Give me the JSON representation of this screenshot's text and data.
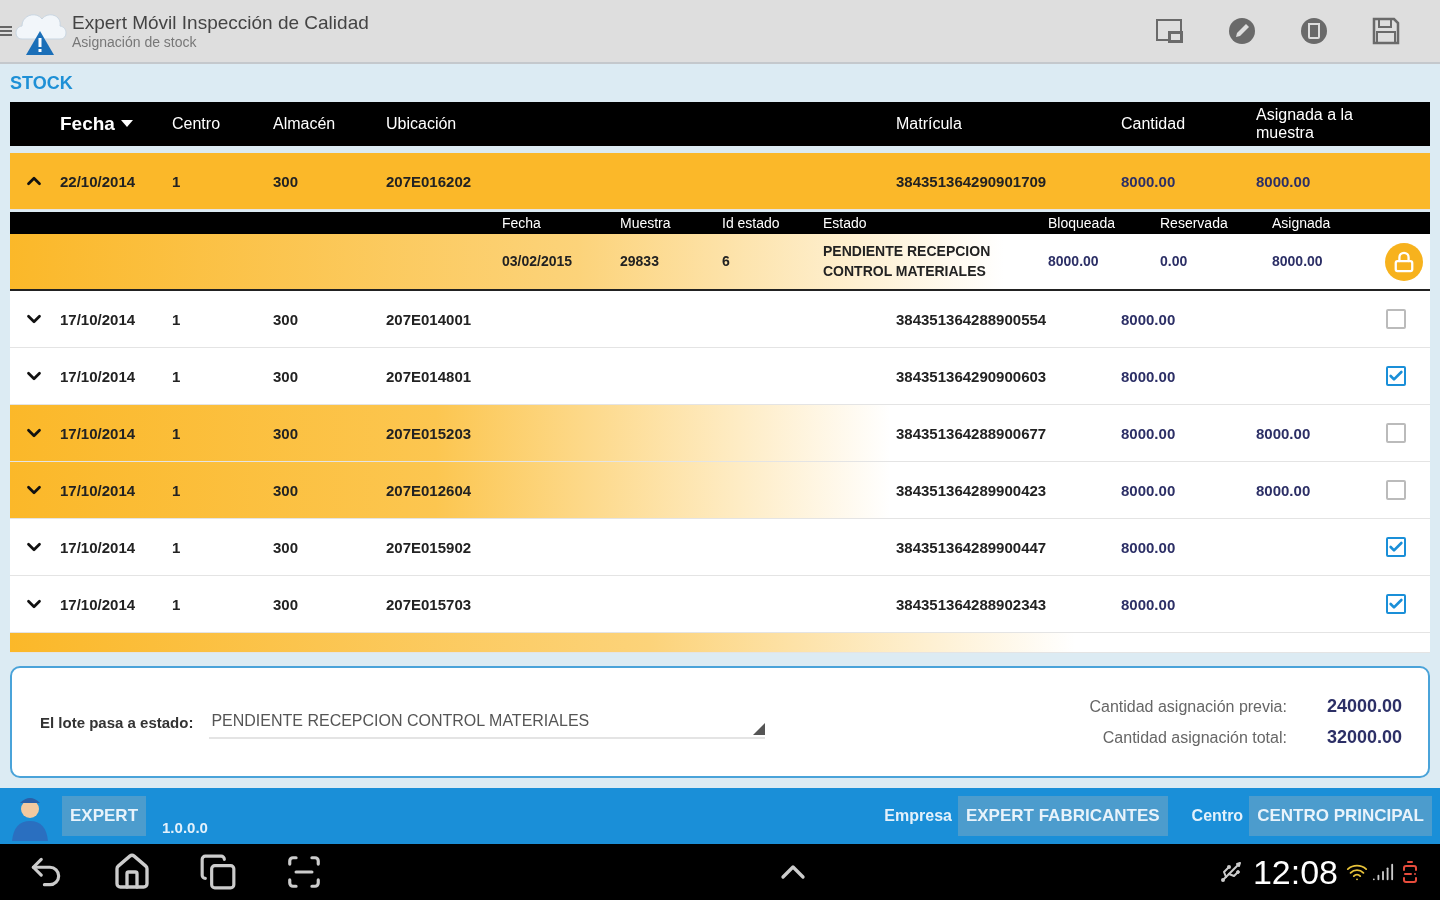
{
  "app_bar": {
    "title": "Expert Móvil Inspección de Calidad",
    "subtitle": "Asignación de stock"
  },
  "section_title": "STOCK",
  "table": {
    "columns": [
      {
        "label": "Fecha",
        "sorted": true
      },
      {
        "label": "Centro",
        "sorted": false
      },
      {
        "label": "Almacén",
        "sorted": false
      },
      {
        "label": "Ubicación",
        "sorted": false
      },
      {
        "label": "Matrícula",
        "sorted": false
      },
      {
        "label": "Cantidad",
        "sorted": false
      },
      {
        "label": "Asignada a la muestra",
        "sorted": false
      }
    ],
    "rows": [
      {
        "expanded": true,
        "highlighted": true,
        "fecha": "22/10/2014",
        "centro": "1",
        "almacen": "300",
        "ubicacion": "207E016202",
        "matricula": "384351364290901709",
        "cantidad": "8000.00",
        "asignada": "8000.00",
        "detail": {
          "columns": [
            "Fecha",
            "Muestra",
            "Id estado",
            "Estado",
            "Bloqueada",
            "Reservada",
            "Asignada"
          ],
          "cells": [
            "03/02/2015",
            "29833",
            "6",
            "PENDIENTE RECEPCION CONTROL MATERIALES",
            "8000.00",
            "0.00",
            "8000.00"
          ],
          "locked": true
        }
      },
      {
        "expanded": false,
        "highlighted": false,
        "checked": false,
        "fecha": "17/10/2014",
        "centro": "1",
        "almacen": "300",
        "ubicacion": "207E014001",
        "matricula": "384351364288900554",
        "cantidad": "8000.00"
      },
      {
        "expanded": false,
        "highlighted": false,
        "checked": true,
        "fecha": "17/10/2014",
        "centro": "1",
        "almacen": "300",
        "ubicacion": "207E014801",
        "matricula": "384351364290900603",
        "cantidad": "8000.00"
      },
      {
        "expanded": false,
        "highlighted": true,
        "checked": false,
        "fecha": "17/10/2014",
        "centro": "1",
        "almacen": "300",
        "ubicacion": "207E015203",
        "matricula": "384351364288900677",
        "cantidad": "8000.00",
        "asignada": "8000.00"
      },
      {
        "expanded": false,
        "highlighted": true,
        "checked": false,
        "fecha": "17/10/2014",
        "centro": "1",
        "almacen": "300",
        "ubicacion": "207E012604",
        "matricula": "384351364289900423",
        "cantidad": "8000.00",
        "asignada": "8000.00"
      },
      {
        "expanded": false,
        "highlighted": false,
        "checked": true,
        "fecha": "17/10/2014",
        "centro": "1",
        "almacen": "300",
        "ubicacion": "207E015902",
        "matricula": "384351364289900447",
        "cantidad": "8000.00"
      },
      {
        "expanded": false,
        "highlighted": false,
        "checked": true,
        "fecha": "17/10/2014",
        "centro": "1",
        "almacen": "300",
        "ubicacion": "207E015703",
        "matricula": "384351364288902343",
        "cantidad": "8000.00"
      },
      {
        "kind": "partial",
        "highlighted": true
      }
    ]
  },
  "batch_state": {
    "label": "El lote pasa a estado:",
    "value": "PENDIENTE RECEPCION CONTROL MATERIALES"
  },
  "totals": [
    {
      "label": "Cantidad asignación previa:",
      "value": "24000.00"
    },
    {
      "label": "Cantidad asignación total:",
      "value": "32000.00"
    }
  ],
  "footer": {
    "user": "EXPERT",
    "version": "1.0.0.0",
    "company_label": "Empresa",
    "company": "EXPERT FABRICANTES",
    "center_label": "Centro",
    "center": "CENTRO PRINCIPAL"
  },
  "system_bar": {
    "time": "12:08"
  }
}
